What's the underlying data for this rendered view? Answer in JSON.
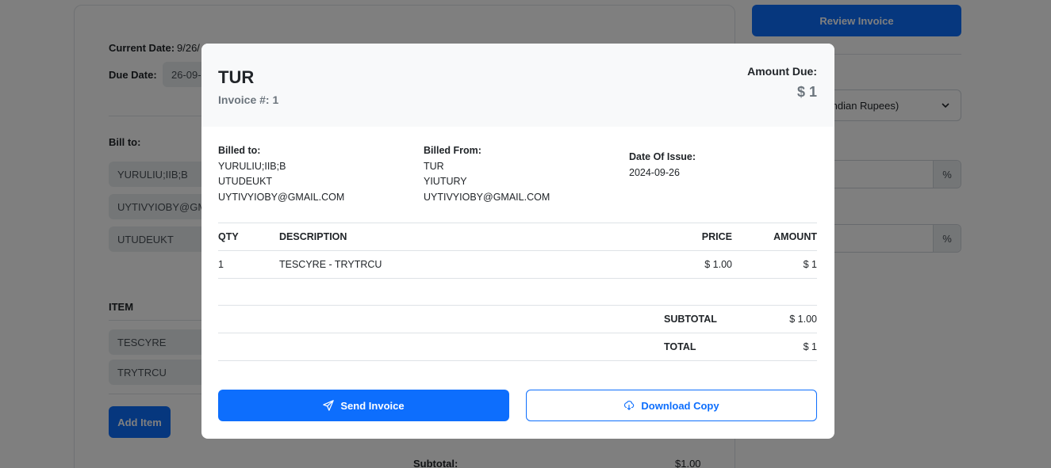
{
  "background": {
    "current_date_label": "Current Date:",
    "current_date_value": "9/26/",
    "due_date_label": "Due Date:",
    "due_date_value": "26-09-",
    "bill_to_label": "Bill to:",
    "bill_to_name": "YURULIU;IIB;B",
    "bill_to_email": "UYTIVYIOBY@GMA",
    "bill_to_address": "UTUDEUKT",
    "item_header": "ITEM",
    "items": [
      "TESCYRE",
      "TRYTRCU"
    ],
    "add_item_label": "Add Item",
    "subtotal_label": "Subtotal:",
    "subtotal_value": "$1.00",
    "review_invoice_label": "Review Invoice",
    "currency_value": "Indian Rupees)",
    "tax_suffix": "%",
    "discount_suffix": "%"
  },
  "modal": {
    "title": "TUR",
    "invoice_number": "Invoice #: 1",
    "amount_due_label": "Amount Due:",
    "amount_due_value": "$ 1",
    "billed_to": {
      "label": "Billed to:",
      "name": "YURULIU;IIB;B",
      "address": "UTUDEUKT",
      "email": "UYTIVYIOBY@GMAIL.COM"
    },
    "billed_from": {
      "label": "Billed From:",
      "name": "TUR",
      "address": "YIUTURY",
      "email": "UYTIVYIOBY@GMAIL.COM"
    },
    "date_of_issue": {
      "label": "Date Of Issue:",
      "value": "2024-09-26"
    },
    "table": {
      "headers": {
        "qty": "QTY",
        "description": "DESCRIPTION",
        "price": "PRICE",
        "amount": "AMOUNT"
      },
      "rows": [
        {
          "qty": "1",
          "description": "TESCYRE - TRYTRCU",
          "price": "$ 1.00",
          "amount": "$ 1"
        }
      ]
    },
    "totals": {
      "subtotal_label": "SUBTOTAL",
      "subtotal_value": "$ 1.00",
      "total_label": "TOTAL",
      "total_value": "$ 1"
    },
    "send_label": "Send Invoice",
    "download_label": "Download Copy",
    "send_icon": "send-icon",
    "download_icon": "cloud-download-icon"
  },
  "colors": {
    "primary": "#0d6efd",
    "backdrop": "rgba(0,0,0,0.5)",
    "muted": "#6c757d"
  }
}
